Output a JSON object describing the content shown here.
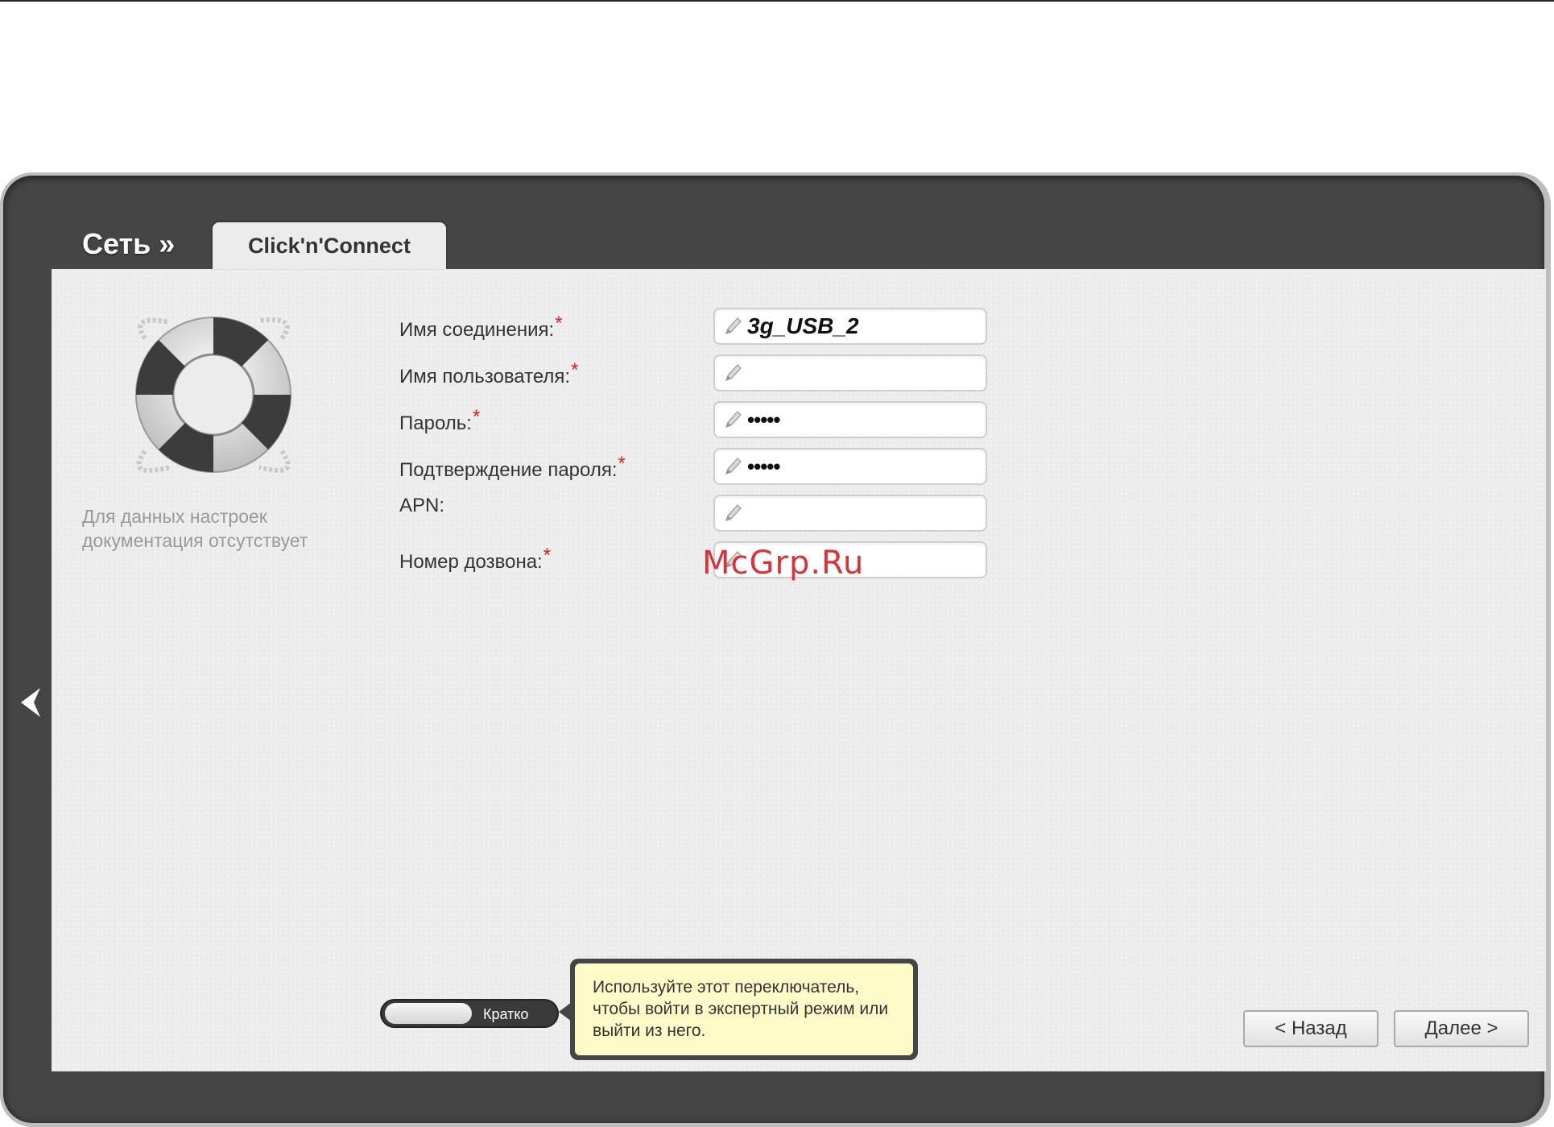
{
  "header": {
    "breadcrumb": "Сеть »",
    "tab_label": "Click'n'Connect"
  },
  "help": {
    "icon": "lifebuoy-icon",
    "text": "Для данных настроек документация отсутствует"
  },
  "form": {
    "fields": [
      {
        "label": "Имя соединения:",
        "required": true,
        "value": "3g_USB_2",
        "type": "text"
      },
      {
        "label": "Имя пользователя:",
        "required": true,
        "value": "",
        "type": "text"
      },
      {
        "label": "Пароль:",
        "required": true,
        "value": "•••••",
        "type": "password"
      },
      {
        "label": "Подтверждение пароля:",
        "required": true,
        "value": "•••••",
        "type": "password"
      },
      {
        "label": "APN:",
        "required": false,
        "value": "",
        "type": "text"
      },
      {
        "label": "Номер дозвона:",
        "required": true,
        "value": "",
        "type": "text"
      }
    ],
    "required_mark": "*"
  },
  "watermark": "McGrp.Ru",
  "mode_toggle": {
    "label": "Кратко"
  },
  "tooltip": {
    "text": "Используйте этот переключатель, чтобы войти в экспертный режим или выйти из него."
  },
  "buttons": {
    "back": "< Назад",
    "next": "Далее >"
  },
  "colors": {
    "frame": "#454545",
    "panel": "#ececec",
    "required": "#e32020",
    "tooltip_bg": "#fefbc9",
    "watermark": "#d9282f"
  }
}
